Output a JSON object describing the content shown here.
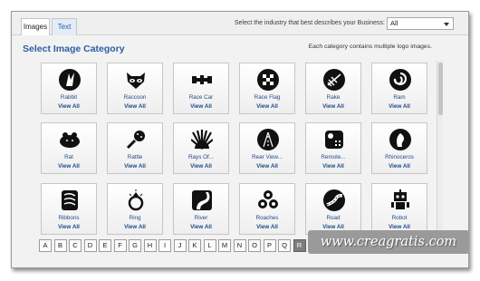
{
  "tabs": [
    {
      "label": "Images"
    },
    {
      "label": "Text"
    }
  ],
  "industry": {
    "label": "Select the industry that best describes your Business:",
    "value": "All"
  },
  "page_title": "Select Image Category",
  "hint": "Each category contains multiple logo images.",
  "categories": [
    {
      "name": "Rabbit",
      "link": "View All",
      "icon": "rabbit-icon"
    },
    {
      "name": "Raccoon",
      "link": "View All",
      "icon": "raccoon-icon"
    },
    {
      "name": "Race Car",
      "link": "View All",
      "icon": "race-car-icon"
    },
    {
      "name": "Race Flag",
      "link": "View All",
      "icon": "race-flag-icon"
    },
    {
      "name": "Rake",
      "link": "View All",
      "icon": "rake-icon"
    },
    {
      "name": "Ram",
      "link": "View All",
      "icon": "ram-icon"
    },
    {
      "name": "Rat",
      "link": "View All",
      "icon": "rat-icon"
    },
    {
      "name": "Rattle",
      "link": "View All",
      "icon": "rattle-icon"
    },
    {
      "name": "Rays Of...",
      "link": "View All",
      "icon": "rays-icon"
    },
    {
      "name": "Rear View...",
      "link": "View All",
      "icon": "rear-view-icon"
    },
    {
      "name": "Remote...",
      "link": "View All",
      "icon": "remote-icon"
    },
    {
      "name": "Rhinoceros",
      "link": "View All",
      "icon": "rhinoceros-icon"
    },
    {
      "name": "Ribbons",
      "link": "View All",
      "icon": "ribbons-icon"
    },
    {
      "name": "Ring",
      "link": "View All",
      "icon": "ring-icon"
    },
    {
      "name": "River",
      "link": "View All",
      "icon": "river-icon"
    },
    {
      "name": "Roaches",
      "link": "View All",
      "icon": "roaches-icon"
    },
    {
      "name": "Road",
      "link": "View All",
      "icon": "road-icon"
    },
    {
      "name": "Robot",
      "link": "View All",
      "icon": "robot-icon"
    }
  ],
  "letters": [
    "A",
    "B",
    "C",
    "D",
    "E",
    "F",
    "G",
    "H",
    "I",
    "J",
    "K",
    "L",
    "M",
    "N",
    "O",
    "P",
    "Q",
    "R"
  ],
  "active_letter": "R",
  "watermark": "www.creagratis.com",
  "colors": {
    "accent": "#2b5fa5",
    "link": "#1f4a8a",
    "active_letter": "#7d7d7d"
  }
}
